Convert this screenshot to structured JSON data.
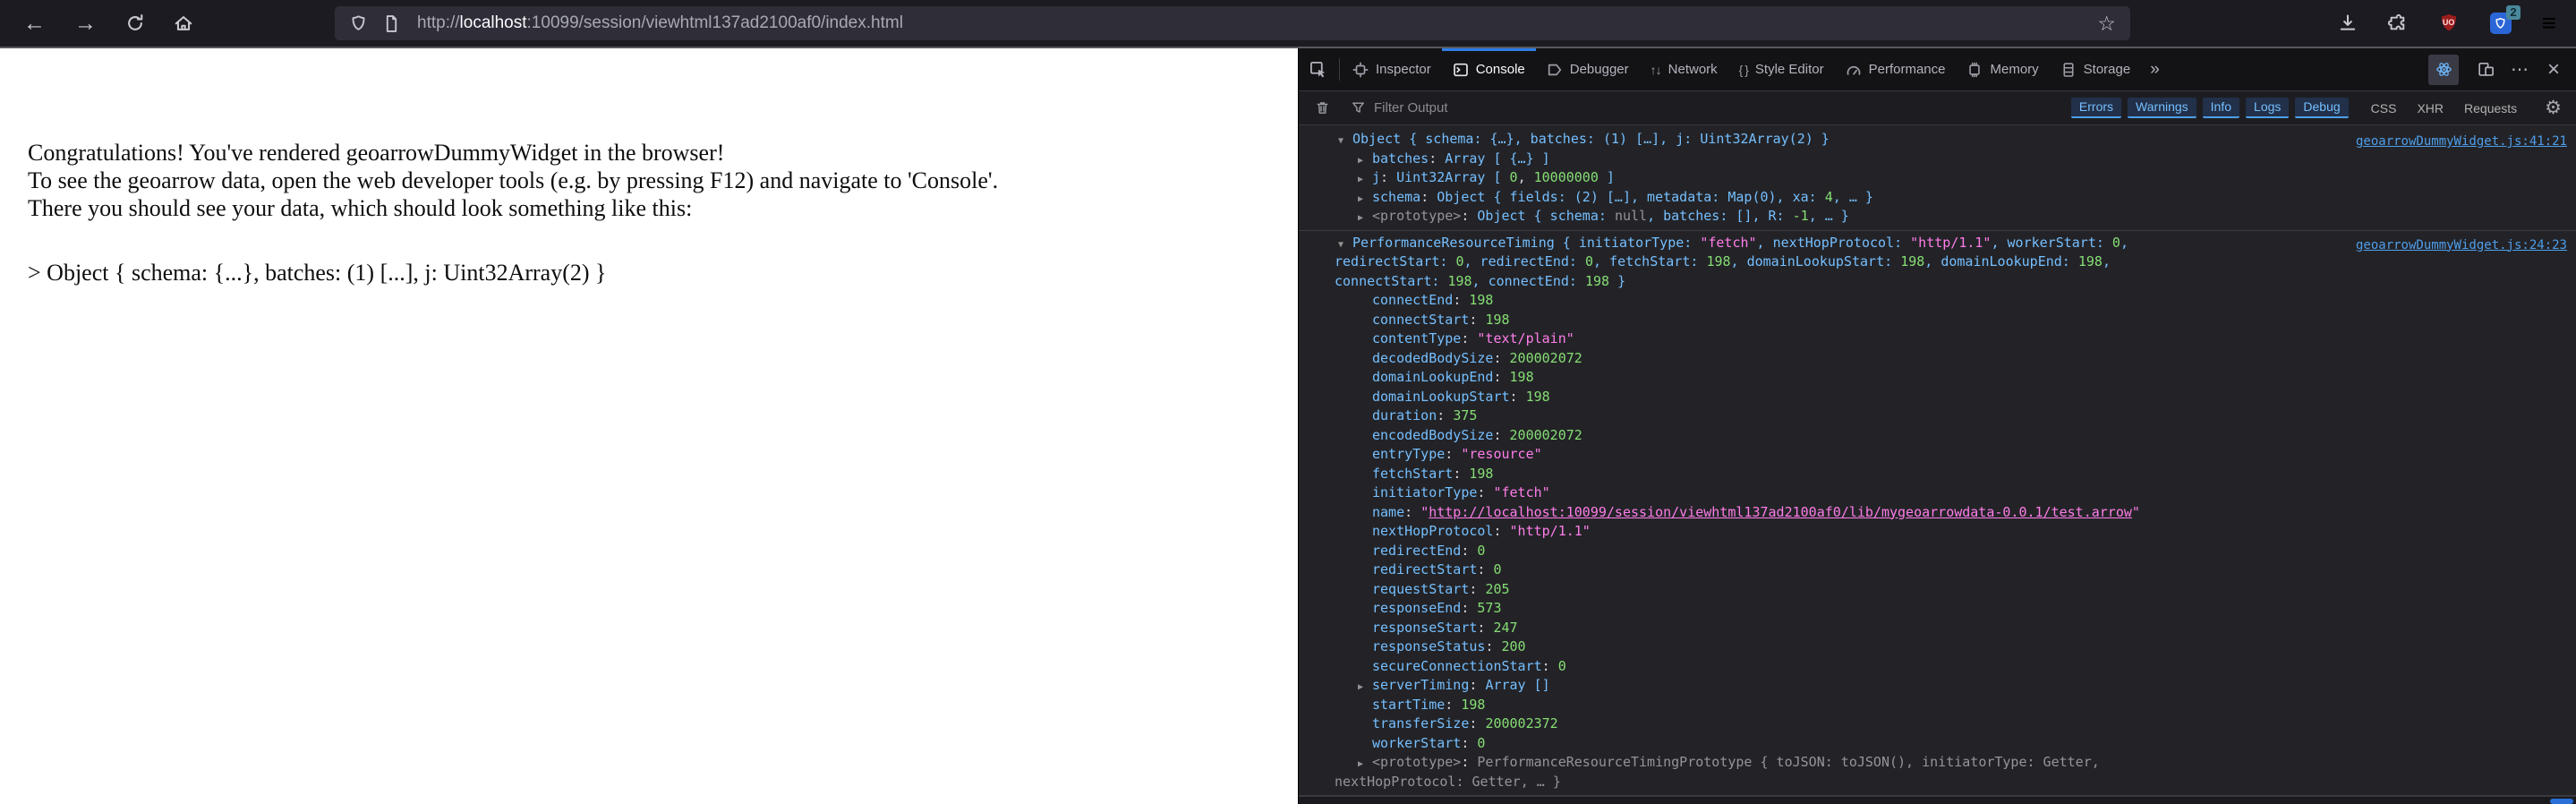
{
  "colors": {
    "accent_blue": "#2e7ce6",
    "console_key": "#75bfff",
    "console_number": "#86de74",
    "console_string": "#ff7de9",
    "source_link": "#4e9eea",
    "ublock_red": "#9b1c1c",
    "extension_blue": "#2b66d9"
  },
  "browser": {
    "icons": {
      "back": "←",
      "forward": "→",
      "star": "☆",
      "menu": "≡"
    },
    "url": {
      "prefix": "http://",
      "host": "localhost",
      "rest": ":10099/session/viewhtml137ad2100af0/index.html"
    },
    "extensions": {
      "ublock_label": "UO",
      "badge_count": "2"
    }
  },
  "page": {
    "lines": [
      "Congratulations! You've rendered geoarrowDummyWidget in the browser!",
      "To see the geoarrow data, open the web developer tools (e.g. by pressing F12) and navigate to 'Console'.",
      "There you should see your data, which should look something like this:"
    ],
    "sample": "> Object { schema: {...}, batches: (1) [...], j: Uint32Array(2) }"
  },
  "devtools": {
    "tabs": [
      {
        "label": "Inspector",
        "icon": "inspector",
        "active": false
      },
      {
        "label": "Console",
        "icon": "console",
        "active": true
      },
      {
        "label": "Debugger",
        "icon": "debugger",
        "active": false
      },
      {
        "label": "Network",
        "icon": "network-arrows",
        "glyph": "↑↓",
        "active": false
      },
      {
        "label": "Style Editor",
        "icon": "braces",
        "glyph": "{ }",
        "active": false
      },
      {
        "label": "Performance",
        "icon": "performance",
        "active": false
      },
      {
        "label": "Memory",
        "icon": "memory",
        "active": false
      },
      {
        "label": "Storage",
        "icon": "storage",
        "active": false
      }
    ],
    "more_tabs_glyph": "»",
    "meatball_glyph": "⋯",
    "close_glyph": "×",
    "gear_glyph": "⚙",
    "filter": {
      "placeholder": "Filter Output",
      "levels": [
        "Errors",
        "Warnings",
        "Info",
        "Logs",
        "Debug"
      ],
      "categories": [
        "CSS",
        "XHR",
        "Requests"
      ]
    },
    "console": {
      "arrow_icons": {
        "v": "▼",
        "r": "▶"
      },
      "entries": [
        {
          "lines": [
            {
              "a": "v",
              "i": 0,
              "link": "geoarrowDummyWidget.js:41:21",
              "s": [
                [
                  "k",
                  "Object { schema: {…}, batches: (1) […], j: Uint32Array(2) }"
                ]
              ]
            },
            {
              "a": "r",
              "i": 1,
              "s": [
                [
                  "k",
                  "batches"
                ],
                [
                  "p",
                  ": "
                ],
                [
                  "k",
                  "Array [ {…} ]"
                ]
              ]
            },
            {
              "a": "r",
              "i": 1,
              "s": [
                [
                  "k",
                  "j"
                ],
                [
                  "p",
                  ": "
                ],
                [
                  "k",
                  "Uint32Array [ "
                ],
                [
                  "n",
                  "0"
                ],
                [
                  "p",
                  ", "
                ],
                [
                  "n",
                  "10000000"
                ],
                [
                  "k",
                  " ]"
                ]
              ]
            },
            {
              "a": "r",
              "i": 1,
              "s": [
                [
                  "k",
                  "schema"
                ],
                [
                  "p",
                  ": "
                ],
                [
                  "k",
                  "Object { fields: (2) […], metadata: Map(0), xa: "
                ],
                [
                  "n",
                  "4"
                ],
                [
                  "k",
                  ", … }"
                ]
              ]
            },
            {
              "a": "r",
              "i": 1,
              "s": [
                [
                  "d",
                  "<prototype>"
                ],
                [
                  "p",
                  ": "
                ],
                [
                  "k",
                  "Object { schema: "
                ],
                [
                  "d",
                  "null"
                ],
                [
                  "k",
                  ", batches: [], R: "
                ],
                [
                  "n",
                  "-1"
                ],
                [
                  "k",
                  ", … }"
                ]
              ]
            }
          ]
        },
        {
          "lines": [
            {
              "a": "v",
              "i": 0,
              "link": "geoarrowDummyWidget.js:24:23",
              "s": [
                [
                  "k",
                  "PerformanceResourceTiming { initiatorType: "
                ],
                [
                  "s",
                  "\"fetch\""
                ],
                [
                  "k",
                  ", nextHopProtocol: "
                ],
                [
                  "s",
                  "\"http/1.1\""
                ],
                [
                  "k",
                  ", workerStart: "
                ],
                [
                  "n",
                  "0"
                ],
                [
                  "k",
                  ","
                ]
              ]
            },
            {
              "i": "c",
              "s": [
                [
                  "k",
                  "redirectStart: "
                ],
                [
                  "n",
                  "0"
                ],
                [
                  "k",
                  ", redirectEnd: "
                ],
                [
                  "n",
                  "0"
                ],
                [
                  "k",
                  ", fetchStart: "
                ],
                [
                  "n",
                  "198"
                ],
                [
                  "k",
                  ", domainLookupStart: "
                ],
                [
                  "n",
                  "198"
                ],
                [
                  "k",
                  ", domainLookupEnd: "
                ],
                [
                  "n",
                  "198"
                ],
                [
                  "k",
                  ","
                ]
              ]
            },
            {
              "i": "c",
              "s": [
                [
                  "k",
                  "connectStart: "
                ],
                [
                  "n",
                  "198"
                ],
                [
                  "k",
                  ", connectEnd: "
                ],
                [
                  "n",
                  "198"
                ],
                [
                  "k",
                  " }"
                ]
              ]
            },
            {
              "i": 1,
              "s": [
                [
                  "k",
                  "connectEnd"
                ],
                [
                  "p",
                  ": "
                ],
                [
                  "n",
                  "198"
                ]
              ]
            },
            {
              "i": 1,
              "s": [
                [
                  "k",
                  "connectStart"
                ],
                [
                  "p",
                  ": "
                ],
                [
                  "n",
                  "198"
                ]
              ]
            },
            {
              "i": 1,
              "s": [
                [
                  "k",
                  "contentType"
                ],
                [
                  "p",
                  ": "
                ],
                [
                  "s",
                  "\"text/plain\""
                ]
              ]
            },
            {
              "i": 1,
              "s": [
                [
                  "k",
                  "decodedBodySize"
                ],
                [
                  "p",
                  ": "
                ],
                [
                  "n",
                  "200002072"
                ]
              ]
            },
            {
              "i": 1,
              "s": [
                [
                  "k",
                  "domainLookupEnd"
                ],
                [
                  "p",
                  ": "
                ],
                [
                  "n",
                  "198"
                ]
              ]
            },
            {
              "i": 1,
              "s": [
                [
                  "k",
                  "domainLookupStart"
                ],
                [
                  "p",
                  ": "
                ],
                [
                  "n",
                  "198"
                ]
              ]
            },
            {
              "i": 1,
              "s": [
                [
                  "k",
                  "duration"
                ],
                [
                  "p",
                  ": "
                ],
                [
                  "n",
                  "375"
                ]
              ]
            },
            {
              "i": 1,
              "s": [
                [
                  "k",
                  "encodedBodySize"
                ],
                [
                  "p",
                  ": "
                ],
                [
                  "n",
                  "200002072"
                ]
              ]
            },
            {
              "i": 1,
              "s": [
                [
                  "k",
                  "entryType"
                ],
                [
                  "p",
                  ": "
                ],
                [
                  "s",
                  "\"resource\""
                ]
              ]
            },
            {
              "i": 1,
              "s": [
                [
                  "k",
                  "fetchStart"
                ],
                [
                  "p",
                  ": "
                ],
                [
                  "n",
                  "198"
                ]
              ]
            },
            {
              "i": 1,
              "s": [
                [
                  "k",
                  "initiatorType"
                ],
                [
                  "p",
                  ": "
                ],
                [
                  "s",
                  "\"fetch\""
                ]
              ]
            },
            {
              "i": 1,
              "s": [
                [
                  "k",
                  "name"
                ],
                [
                  "p",
                  ": "
                ],
                [
                  "s",
                  "\""
                ],
                [
                  "u",
                  "http://localhost:10099/session/viewhtml137ad2100af0/lib/mygeoarrowdata-0.0.1/test.arrow"
                ],
                [
                  "s",
                  "\""
                ]
              ]
            },
            {
              "i": 1,
              "s": [
                [
                  "k",
                  "nextHopProtocol"
                ],
                [
                  "p",
                  ": "
                ],
                [
                  "s",
                  "\"http/1.1\""
                ]
              ]
            },
            {
              "i": 1,
              "s": [
                [
                  "k",
                  "redirectEnd"
                ],
                [
                  "p",
                  ": "
                ],
                [
                  "n",
                  "0"
                ]
              ]
            },
            {
              "i": 1,
              "s": [
                [
                  "k",
                  "redirectStart"
                ],
                [
                  "p",
                  ": "
                ],
                [
                  "n",
                  "0"
                ]
              ]
            },
            {
              "i": 1,
              "s": [
                [
                  "k",
                  "requestStart"
                ],
                [
                  "p",
                  ": "
                ],
                [
                  "n",
                  "205"
                ]
              ]
            },
            {
              "i": 1,
              "s": [
                [
                  "k",
                  "responseEnd"
                ],
                [
                  "p",
                  ": "
                ],
                [
                  "n",
                  "573"
                ]
              ]
            },
            {
              "i": 1,
              "s": [
                [
                  "k",
                  "responseStart"
                ],
                [
                  "p",
                  ": "
                ],
                [
                  "n",
                  "247"
                ]
              ]
            },
            {
              "i": 1,
              "s": [
                [
                  "k",
                  "responseStatus"
                ],
                [
                  "p",
                  ": "
                ],
                [
                  "n",
                  "200"
                ]
              ]
            },
            {
              "i": 1,
              "s": [
                [
                  "k",
                  "secureConnectionStart"
                ],
                [
                  "p",
                  ": "
                ],
                [
                  "n",
                  "0"
                ]
              ]
            },
            {
              "a": "r",
              "i": 1,
              "s": [
                [
                  "k",
                  "serverTiming"
                ],
                [
                  "p",
                  ": "
                ],
                [
                  "k",
                  "Array []"
                ]
              ]
            },
            {
              "i": 1,
              "s": [
                [
                  "k",
                  "startTime"
                ],
                [
                  "p",
                  ": "
                ],
                [
                  "n",
                  "198"
                ]
              ]
            },
            {
              "i": 1,
              "s": [
                [
                  "k",
                  "transferSize"
                ],
                [
                  "p",
                  ": "
                ],
                [
                  "n",
                  "200002372"
                ]
              ]
            },
            {
              "i": 1,
              "s": [
                [
                  "k",
                  "workerStart"
                ],
                [
                  "p",
                  ": "
                ],
                [
                  "n",
                  "0"
                ]
              ]
            },
            {
              "a": "r",
              "i": 1,
              "s": [
                [
                  "d",
                  "<prototype>"
                ],
                [
                  "p",
                  ": "
                ],
                [
                  "d",
                  "PerformanceResourceTimingPrototype { toJSON: toJSON(), initiatorType: Getter,"
                ]
              ]
            },
            {
              "i": "c",
              "s": [
                [
                  "d",
                  "nextHopProtocol: Getter, … }"
                ]
              ]
            }
          ]
        }
      ]
    }
  }
}
